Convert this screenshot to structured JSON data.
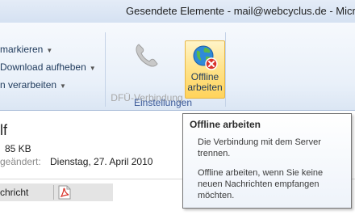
{
  "window": {
    "title": "Gesendete Elemente - mail@webcyclus.de - Micros"
  },
  "ribbon": {
    "menu_items": [
      {
        "label": "markieren"
      },
      {
        "label": "Download aufheben"
      },
      {
        "label": "n verarbeiten"
      }
    ],
    "dfu_label": "DFÜ-Verbindung",
    "offline_label_line1": "Offline",
    "offline_label_line2": "arbeiten",
    "group_label": "Einstellungen"
  },
  "message": {
    "subject_fragment": "lf",
    "size": "85 KB",
    "changed_label": "geändert:",
    "changed_value": "Dienstag, 27. April 2010",
    "attach_label": "chricht"
  },
  "tooltip": {
    "title": "Offline arbeiten",
    "para1": "Die Verbindung mit dem Server trennen.",
    "para2": "Offline arbeiten, wenn Sie keine neuen Nachrichten empfangen möchten."
  },
  "icons": {
    "dfu": "phone-handset-icon",
    "offline": "globe-with-red-x-icon",
    "attachment": "pdf-file-icon"
  },
  "colors": {
    "ribbon_background": "#e9f0f9",
    "highlight_button": "#ffe48e",
    "highlight_border": "#e8b746",
    "text_dark_blue": "#1e395b",
    "error_red": "#d9342b"
  }
}
